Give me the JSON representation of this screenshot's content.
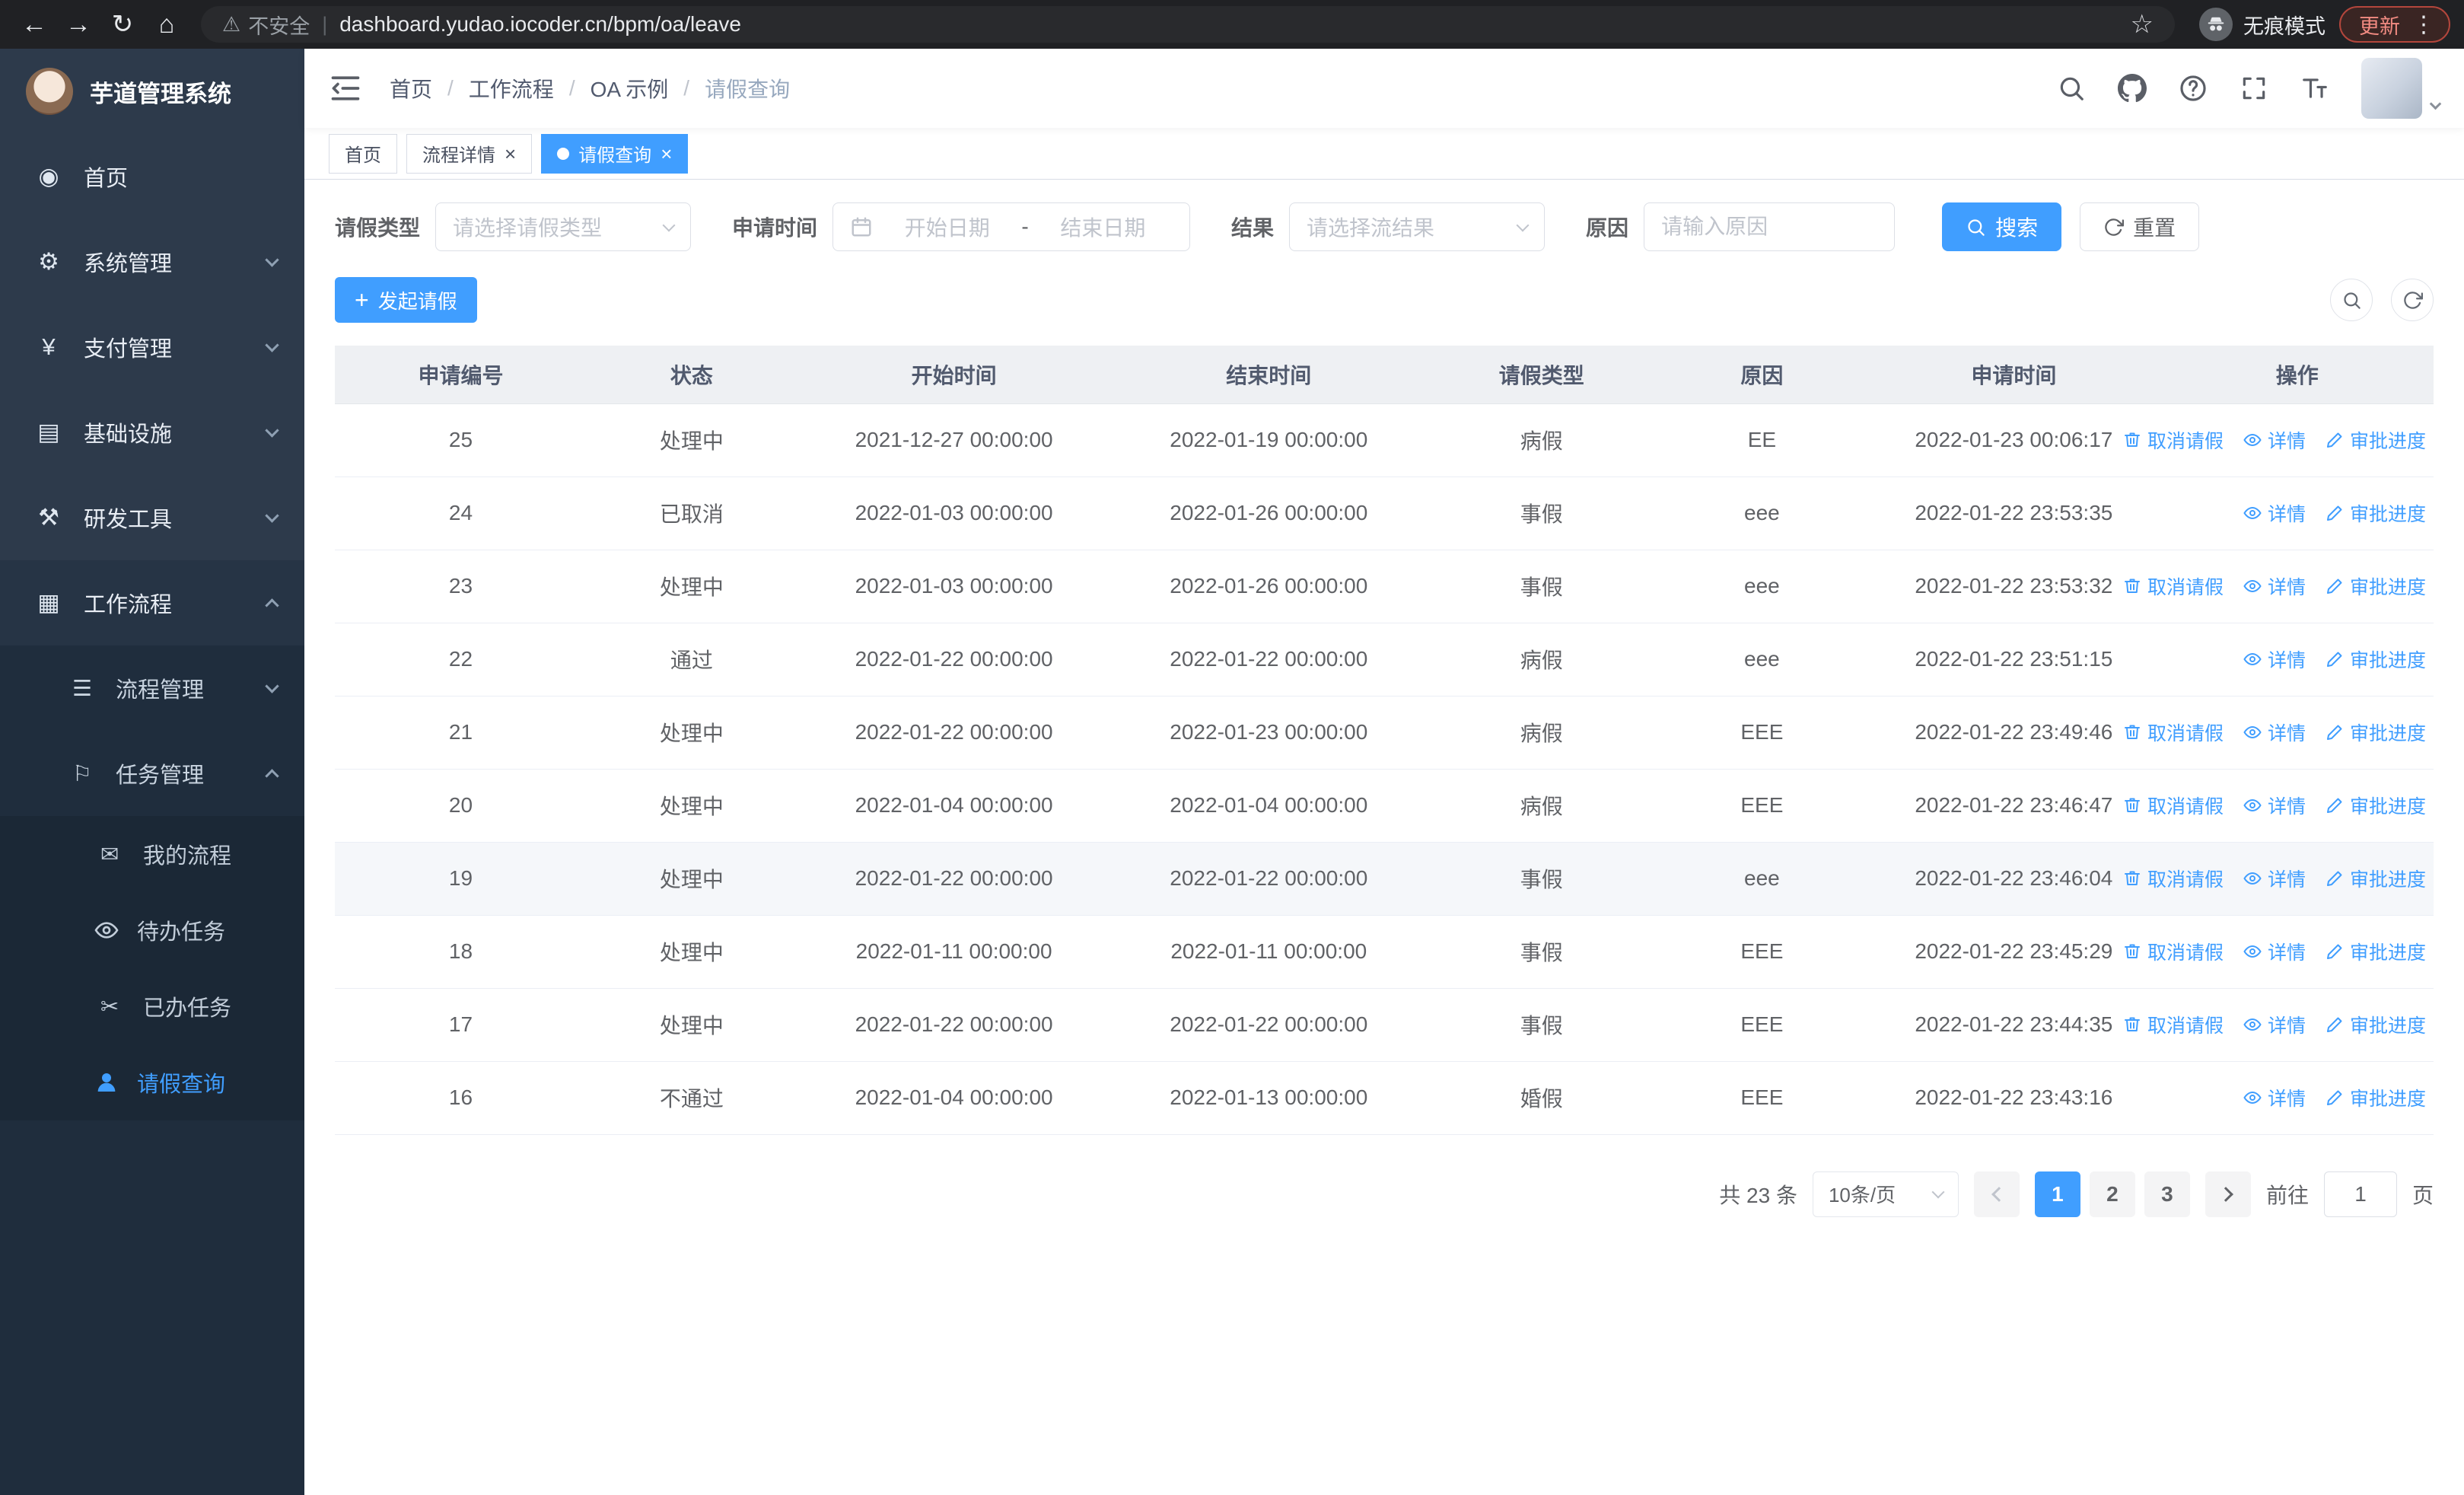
{
  "colors": {
    "primary": "#409eff",
    "sidebar_bg": "#2d3a4b",
    "submenu_bg": "#1f2d3d",
    "table_header_bg": "#eef0f3"
  },
  "browser": {
    "security_label": "不安全",
    "url": "dashboard.yudao.iocoder.cn/bpm/oa/leave",
    "incognito_label": "无痕模式",
    "update_label": "更新"
  },
  "icons": {
    "back": "←",
    "forward": "→",
    "reload": "↻",
    "home": "⌂",
    "warning": "⚠",
    "divider": "|",
    "star": "☆",
    "menu_dots": "⋮",
    "dashboard": "◉",
    "gear": "⚙",
    "yen": "¥",
    "infra": "▤",
    "tools": "⚒",
    "workflow": "▦",
    "process_list": "☰",
    "task_flag": "⚐",
    "message": "✉",
    "scissors": "✂",
    "plus": "+"
  },
  "sidebar": {
    "title": "芋道管理系统",
    "home": "首页",
    "system": "系统管理",
    "payment": "支付管理",
    "infra": "基础设施",
    "devtools": "研发工具",
    "workflow": "工作流程",
    "process_mgmt": "流程管理",
    "task_mgmt": "任务管理",
    "my_process": "我的流程",
    "todo_tasks": "待办任务",
    "done_tasks": "已办任务",
    "leave_query": "请假查询"
  },
  "navbar": {
    "breadcrumb": [
      "首页",
      "工作流程",
      "OA 示例",
      "请假查询"
    ],
    "breadcrumb_separator": "/"
  },
  "tabs": {
    "close_glyph": "×",
    "items": [
      {
        "label": "首页",
        "closable": false,
        "active": false
      },
      {
        "label": "流程详情",
        "closable": true,
        "active": false
      },
      {
        "label": "请假查询",
        "closable": true,
        "active": true
      }
    ]
  },
  "filters": {
    "leave_type_label": "请假类型",
    "leave_type_placeholder": "请选择请假类型",
    "apply_time_label": "申请时间",
    "start_date_placeholder": "开始日期",
    "date_separator": "-",
    "end_date_placeholder": "结束日期",
    "result_label": "结果",
    "result_placeholder": "请选择流结果",
    "reason_label": "原因",
    "reason_placeholder": "请输入原因",
    "search_button": "搜索",
    "reset_button": "重置"
  },
  "toolbar": {
    "create_button": "发起请假"
  },
  "table": {
    "headers": [
      "申请编号",
      "状态",
      "开始时间",
      "结束时间",
      "请假类型",
      "原因",
      "申请时间",
      "操作"
    ],
    "actions": {
      "cancel": "取消请假",
      "detail": "详情",
      "progress": "审批进度"
    },
    "rows": [
      {
        "id": "25",
        "status": "处理中",
        "start": "2021-12-27 00:00:00",
        "end": "2022-01-19 00:00:00",
        "type": "病假",
        "reason": "EE",
        "apply_time": "2022-01-23 00:06:17",
        "cancellable": true,
        "highlight": false
      },
      {
        "id": "24",
        "status": "已取消",
        "start": "2022-01-03 00:00:00",
        "end": "2022-01-26 00:00:00",
        "type": "事假",
        "reason": "eee",
        "apply_time": "2022-01-22 23:53:35",
        "cancellable": false,
        "highlight": false
      },
      {
        "id": "23",
        "status": "处理中",
        "start": "2022-01-03 00:00:00",
        "end": "2022-01-26 00:00:00",
        "type": "事假",
        "reason": "eee",
        "apply_time": "2022-01-22 23:53:32",
        "cancellable": true,
        "highlight": false
      },
      {
        "id": "22",
        "status": "通过",
        "start": "2022-01-22 00:00:00",
        "end": "2022-01-22 00:00:00",
        "type": "病假",
        "reason": "eee",
        "apply_time": "2022-01-22 23:51:15",
        "cancellable": false,
        "highlight": false
      },
      {
        "id": "21",
        "status": "处理中",
        "start": "2022-01-22 00:00:00",
        "end": "2022-01-23 00:00:00",
        "type": "病假",
        "reason": "EEE",
        "apply_time": "2022-01-22 23:49:46",
        "cancellable": true,
        "highlight": false
      },
      {
        "id": "20",
        "status": "处理中",
        "start": "2022-01-04 00:00:00",
        "end": "2022-01-04 00:00:00",
        "type": "病假",
        "reason": "EEE",
        "apply_time": "2022-01-22 23:46:47",
        "cancellable": true,
        "highlight": false
      },
      {
        "id": "19",
        "status": "处理中",
        "start": "2022-01-22 00:00:00",
        "end": "2022-01-22 00:00:00",
        "type": "事假",
        "reason": "eee",
        "apply_time": "2022-01-22 23:46:04",
        "cancellable": true,
        "highlight": true
      },
      {
        "id": "18",
        "status": "处理中",
        "start": "2022-01-11 00:00:00",
        "end": "2022-01-11 00:00:00",
        "type": "事假",
        "reason": "EEE",
        "apply_time": "2022-01-22 23:45:29",
        "cancellable": true,
        "highlight": false
      },
      {
        "id": "17",
        "status": "处理中",
        "start": "2022-01-22 00:00:00",
        "end": "2022-01-22 00:00:00",
        "type": "事假",
        "reason": "EEE",
        "apply_time": "2022-01-22 23:44:35",
        "cancellable": true,
        "highlight": false
      },
      {
        "id": "16",
        "status": "不通过",
        "start": "2022-01-04 00:00:00",
        "end": "2022-01-13 00:00:00",
        "type": "婚假",
        "reason": "EEE",
        "apply_time": "2022-01-22 23:43:16",
        "cancellable": false,
        "highlight": false
      }
    ]
  },
  "pagination": {
    "total": "共 23 条",
    "page_size": "10条/页",
    "pages": [
      "1",
      "2",
      "3"
    ],
    "active_page": "1",
    "goto_label": "前往",
    "goto_value": "1",
    "goto_unit": "页"
  }
}
